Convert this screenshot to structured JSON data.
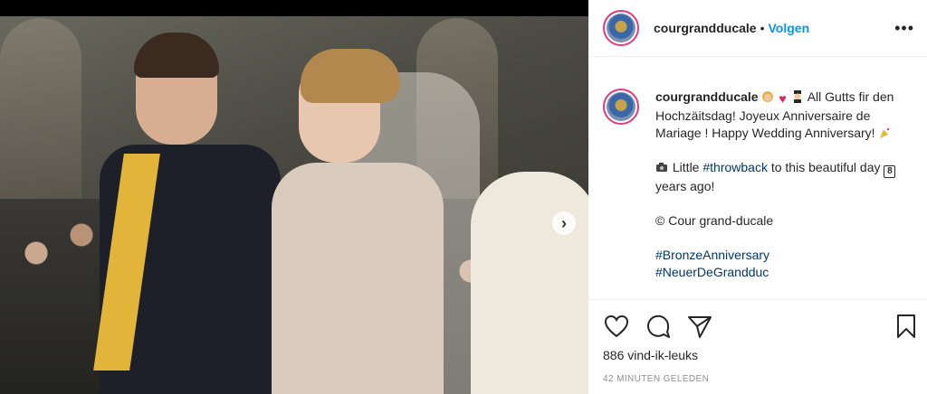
{
  "post": {
    "username": "courgrandducale",
    "follow_label": "Volgen",
    "separator": "•",
    "more_label": "•••"
  },
  "caption": {
    "username": "courgrandducale",
    "line1": "All Gutts fir den Hochzäitsdag! Joyeux Anniversaire de Mariage ! Happy Wedding Anniversary!",
    "line2_prefix": "Little",
    "line2_tag": "#throwback",
    "line2_suffix_a": "to this beautiful day",
    "line2_number": "8",
    "line2_suffix_b": "years ago!",
    "line3": "© Cour grand-ducale",
    "line4_tag": "#BronzeAnniversary",
    "line5_tag": "#NeuerDeGrandduc"
  },
  "stats": {
    "likes": "886 vind-ik-leuks",
    "timestamp": "42 MINUTEN GELEDEN"
  },
  "icons": {
    "like": "heart-icon",
    "comment": "comment-icon",
    "share": "share-icon",
    "save": "bookmark-icon",
    "next": "chevron-right-icon"
  },
  "colors": {
    "link_blue": "#0095f6",
    "hashtag": "#00376b",
    "text": "#262626",
    "muted": "#8e8e8e",
    "story_ring": "#e23a7a"
  }
}
